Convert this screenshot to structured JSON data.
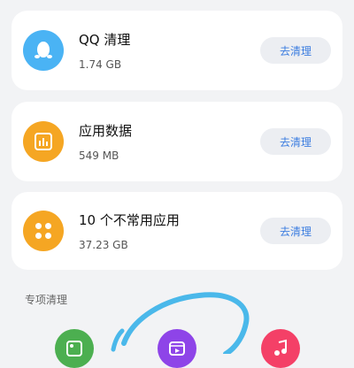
{
  "cards": [
    {
      "title": "QQ 清理",
      "size": "1.74 GB",
      "button": "去清理",
      "icon": "qq-penguin-icon",
      "color": "#4ab3f4"
    },
    {
      "title": "应用数据",
      "size": "549 MB",
      "button": "去清理",
      "icon": "bar-chart-icon",
      "color": "#f5a623"
    },
    {
      "title": "10 个不常用应用",
      "size": "37.23 GB",
      "button": "去清理",
      "icon": "app-grid-icon",
      "color": "#f5a623"
    }
  ],
  "special": {
    "title": "专项清理",
    "icons": [
      {
        "icon": "image-icon",
        "color": "#4caf50"
      },
      {
        "icon": "video-icon",
        "color": "#8e44e8"
      },
      {
        "icon": "music-icon",
        "color": "#f44067"
      }
    ]
  },
  "colors": {
    "accent": "#3b7de0",
    "annotation": "#4ab8ea"
  }
}
